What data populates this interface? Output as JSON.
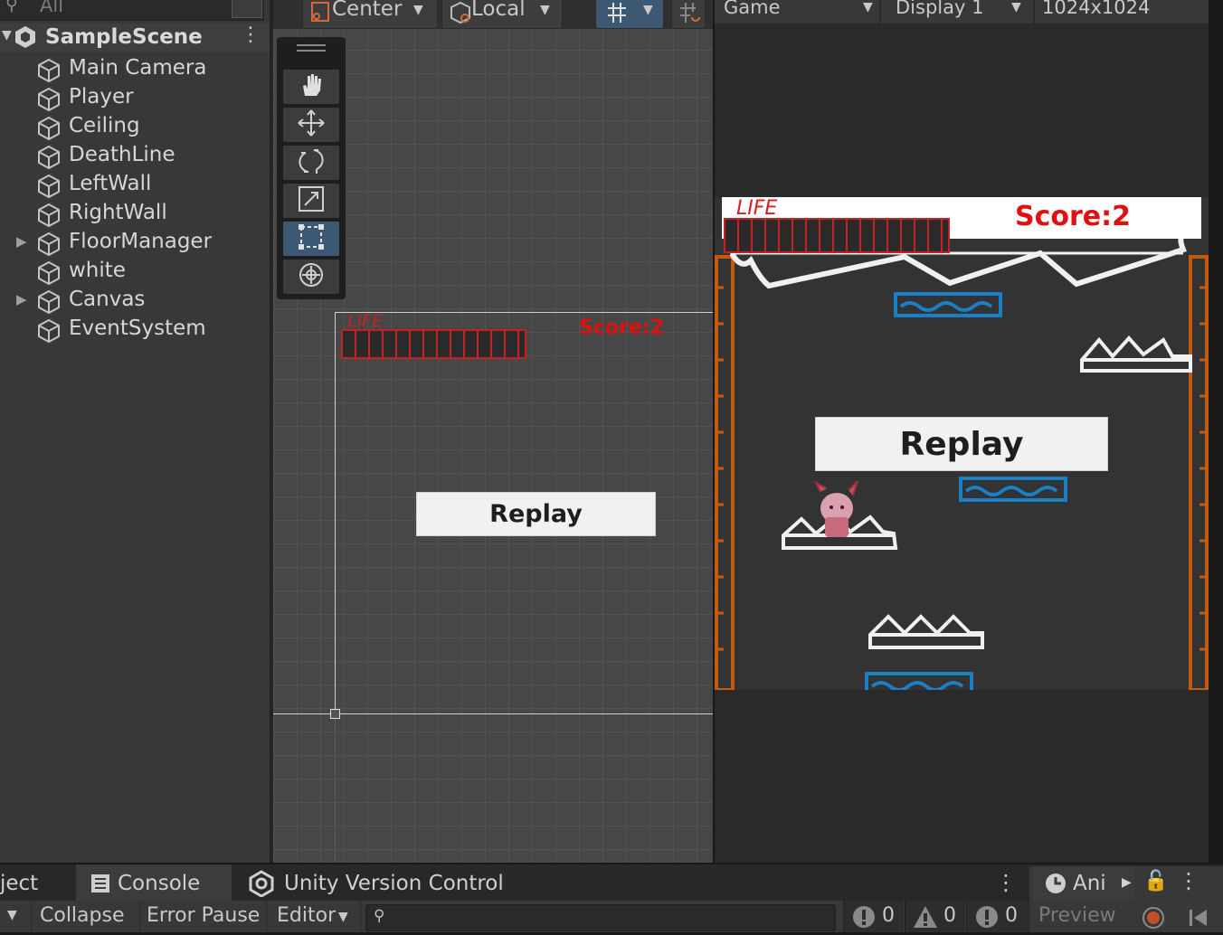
{
  "hierarchy": {
    "search_placeholder": "All",
    "scene_name": "SampleScene",
    "items": [
      {
        "label": "Main Camera",
        "expandable": false
      },
      {
        "label": "Player",
        "expandable": false
      },
      {
        "label": "Ceiling",
        "expandable": false
      },
      {
        "label": "DeathLine",
        "expandable": false
      },
      {
        "label": "LeftWall",
        "expandable": false
      },
      {
        "label": "RightWall",
        "expandable": false
      },
      {
        "label": "FloorManager",
        "expandable": true
      },
      {
        "label": "white",
        "expandable": false
      },
      {
        "label": "Canvas",
        "expandable": true
      },
      {
        "label": "EventSystem",
        "expandable": false
      }
    ]
  },
  "scene_toolbar": {
    "pivot_label": "Center",
    "space_label": "Local"
  },
  "scene_ui": {
    "life_label": "LIFE",
    "score_label": "Score:2",
    "replay_label": "Replay"
  },
  "game_toolbar": {
    "view_label": "Game",
    "display_label": "Display 1",
    "resolution_label": "1024x1024"
  },
  "game_ui": {
    "life_label": "LIFE",
    "score_label": "Score:2",
    "replay_label": "Replay"
  },
  "bottom_tabs": {
    "project_label": "ject",
    "console_label": "Console",
    "vc_label": "Unity Version Control",
    "anim_label": "Ani",
    "preview_label": "Preview"
  },
  "console": {
    "collapse_label": "Collapse",
    "error_pause_label": "Error Pause",
    "editor_label": "Editor",
    "log_count": "0",
    "warn_count": "0",
    "error_count": "0"
  },
  "colors": {
    "accent_red": "#e01010",
    "active_tool": "#3d5873",
    "platform_blue": "#1a7fc4",
    "wall_orange": "#c45a10"
  }
}
